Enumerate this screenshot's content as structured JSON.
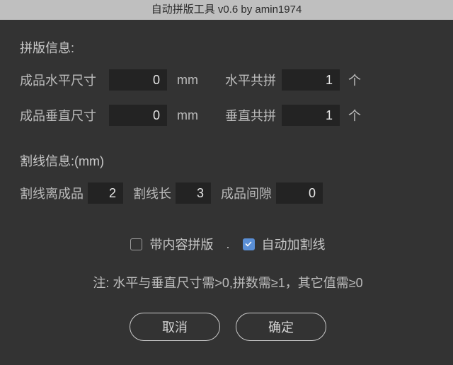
{
  "title": "自动拼版工具 v0.6    by amin1974",
  "section1": {
    "header": "拼版信息:",
    "row1": {
      "label1": "成品水平尺寸",
      "value1": "0",
      "unit": "mm",
      "label2": "水平共拼",
      "value2": "1",
      "unit2": "个"
    },
    "row2": {
      "label1": "成品垂直尺寸",
      "value1": "0",
      "unit": "mm",
      "label2": "垂直共拼",
      "value2": "1",
      "unit2": "个"
    }
  },
  "section2": {
    "header": "割线信息:(mm)",
    "f1": {
      "label": "割线离成品",
      "value": "2"
    },
    "f2": {
      "label": "割线长",
      "value": "3"
    },
    "f3": {
      "label": "成品间隙",
      "value": "0"
    }
  },
  "options": {
    "cb1": {
      "label": "带内容拼版",
      "checked": false
    },
    "cb2": {
      "label": "自动加割线",
      "checked": true
    },
    "separator": "."
  },
  "note": "注:  水平与垂直尺寸需>0,拼数需≥1，其它值需≥0",
  "buttons": {
    "cancel": "取消",
    "ok": "确定"
  }
}
